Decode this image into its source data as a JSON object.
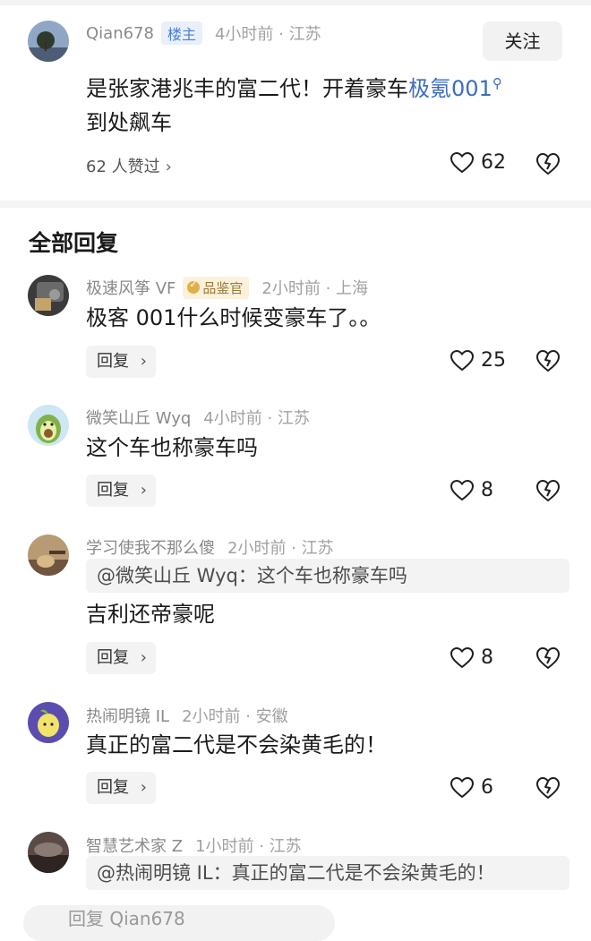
{
  "op": {
    "username": "Qian678",
    "badge": "楼主",
    "time": "4小时前 · 江苏",
    "follow_label": "关注",
    "content_line1": "是张家港兆丰的富二代！开着豪车",
    "content_link": "极氪001",
    "content_line2": "到处飙车",
    "likers": "62 人赞过",
    "likes": "62"
  },
  "section_title": "全部回复",
  "replies": [
    {
      "username": "极速风筝 VF",
      "badge": "品鉴官",
      "time": "2小时前 · 上海",
      "content": "极客 001什么时候变豪车了。。",
      "reply_label": "回复",
      "likes": "25"
    },
    {
      "username": "微笑山丘 Wyq",
      "time": "4小时前 · 江苏",
      "content": "这个车也称豪车吗",
      "reply_label": "回复",
      "likes": "8"
    },
    {
      "username": "学习使我不那么傻",
      "time": "2小时前 · 江苏",
      "quote": "@微笑山丘 Wyq：这个车也称豪车吗",
      "content": "吉利还帝豪呢",
      "reply_label": "回复",
      "likes": "8"
    },
    {
      "username": "热闹明镜 IL",
      "time": "2小时前 · 安徽",
      "content": "真正的富二代是不会染黄毛的！",
      "reply_label": "回复",
      "likes": "6"
    },
    {
      "username": "智慧艺术家 Z",
      "time": "1小时前 · 江苏",
      "quote": "@热闹明镜 IL：真正的富二代是不会染黄毛的！"
    }
  ],
  "bottom": {
    "input_placeholder": "回复 Qian678"
  },
  "icons": {
    "like": "heart-outline-icon",
    "dislike": "broken-heart-icon",
    "chevron": "chevron-right-icon",
    "search": "search-icon"
  },
  "colors": {
    "link": "#3c6cbf",
    "badge_lz_bg": "#e9f0fb",
    "badge_pjg_bg": "#fbf1dd",
    "chip_bg": "#f3f3f3"
  }
}
